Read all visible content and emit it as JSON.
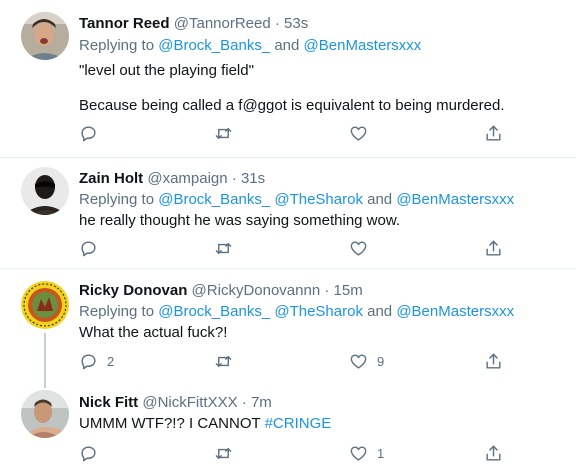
{
  "tweets": [
    {
      "name": "Tannor Reed",
      "handle": "@TannorReed",
      "sep": "·",
      "time": "53s",
      "replying_prefix": "Replying to ",
      "replying_a": "@Brock_Banks_",
      "replying_and": " and ",
      "replying_b": "@BenMastersxxx",
      "text1": "\"level out the playing field\"",
      "text2": "Because being called a f@ggot is equivalent to being murdered."
    },
    {
      "name": "Zain Holt",
      "handle": "@xampaign",
      "sep": "·",
      "time": "31s",
      "replying_prefix": "Replying to ",
      "replying_a": "@Brock_Banks_",
      "replying_b": "@TheSharok",
      "replying_and": " and ",
      "replying_c": "@BenMastersxxx",
      "text1": "he really thought he was saying something wow."
    },
    {
      "name": "Ricky Donovan",
      "handle": "@RickyDonovannn",
      "sep": "·",
      "time": "15m",
      "replying_prefix": "Replying to ",
      "replying_a": "@Brock_Banks_",
      "replying_b": "@TheSharok",
      "replying_and": " and ",
      "replying_c": "@BenMastersxxx",
      "text1": "What the actual fuck?!",
      "reply_count": "2",
      "like_count": "9"
    },
    {
      "name": "Nick Fitt",
      "handle": "@NickFittXXX",
      "sep": "·",
      "time": "7m",
      "text1": "UMMM WTF?!? I CANNOT ",
      "hashtag": "#CRINGE",
      "like_count": "1"
    }
  ],
  "icons": {
    "reply": "reply-icon",
    "retweet": "retweet-icon",
    "like": "heart-icon",
    "share": "share-icon"
  },
  "colors": {
    "link": "#1b95e0",
    "secondary": "#5b7083",
    "divider": "#e6ecf0",
    "thread_line": "#c4cfd6"
  }
}
